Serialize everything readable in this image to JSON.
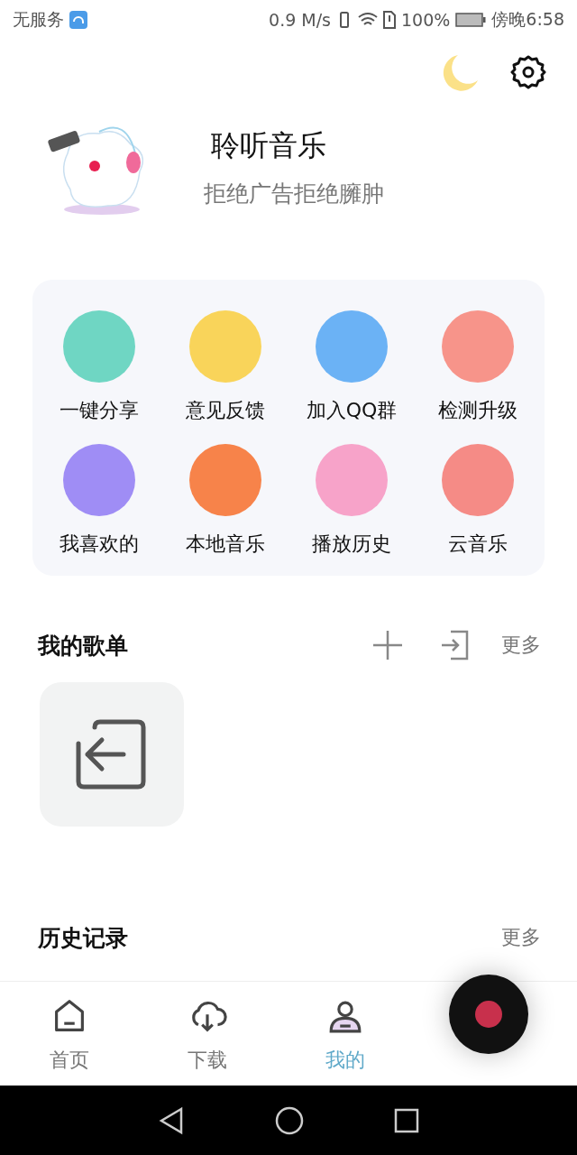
{
  "status_bar": {
    "carrier": "无服务",
    "speed": "0.9 M/s",
    "battery": "100%",
    "time": "傍晚6:58"
  },
  "profile": {
    "title": "聆听音乐",
    "subtitle": "拒绝广告拒绝臃肿"
  },
  "shortcuts": [
    {
      "label": "一键分享",
      "color": "#6fd6c3"
    },
    {
      "label": "意见反馈",
      "color": "#f9d45a"
    },
    {
      "label": "加入QQ群",
      "color": "#6bb2f5"
    },
    {
      "label": "检测升级",
      "color": "#f7948a"
    },
    {
      "label": "我喜欢的",
      "color": "#9f8df5"
    },
    {
      "label": "本地音乐",
      "color": "#f7834a"
    },
    {
      "label": "播放历史",
      "color": "#f7a3c9"
    },
    {
      "label": "云音乐",
      "color": "#f58b86"
    }
  ],
  "playlists": {
    "title": "我的歌单",
    "more": "更多"
  },
  "history": {
    "title": "历史记录",
    "more": "更多"
  },
  "bottom_nav": [
    {
      "label": "首页",
      "selected": false
    },
    {
      "label": "下载",
      "selected": false
    },
    {
      "label": "我的",
      "selected": true
    }
  ]
}
